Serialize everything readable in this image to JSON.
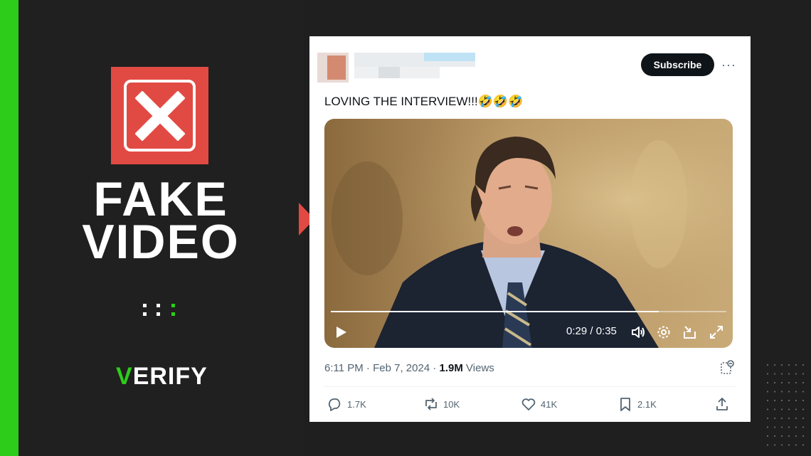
{
  "verdict": {
    "line1": "FAKE",
    "line2": "VIDEO"
  },
  "brand": {
    "check": "V",
    "rest": "ERIFY"
  },
  "tweet": {
    "subscribe_label": "Subscribe",
    "more_label": "···",
    "text": "LOVING THE INTERVIEW!!!🤣🤣🤣",
    "video": {
      "time_label": "0:29 / 0:35",
      "progress_fraction": 0.83
    },
    "meta": {
      "time": "6:11 PM",
      "separator1": "·",
      "date": "Feb 7, 2024",
      "separator2": "·",
      "views_count": "1.9M",
      "views_label": "Views"
    },
    "actions": {
      "replies": "1.7K",
      "reposts": "10K",
      "likes": "41K",
      "bookmarks": "2.1K"
    }
  },
  "colors": {
    "green": "#2ecc1a",
    "red": "#e14a43",
    "background": "#1f1f1f"
  },
  "icons": {
    "fake": "x-in-box-icon",
    "play": "play-icon",
    "volume": "volume-icon",
    "settings": "gear-icon",
    "pip": "pip-icon",
    "fullscreen": "fullscreen-icon",
    "reply": "reply-icon",
    "repost": "repost-icon",
    "like": "heart-icon",
    "bookmark": "bookmark-icon",
    "share": "share-icon",
    "analytics": "analytics-icon"
  }
}
